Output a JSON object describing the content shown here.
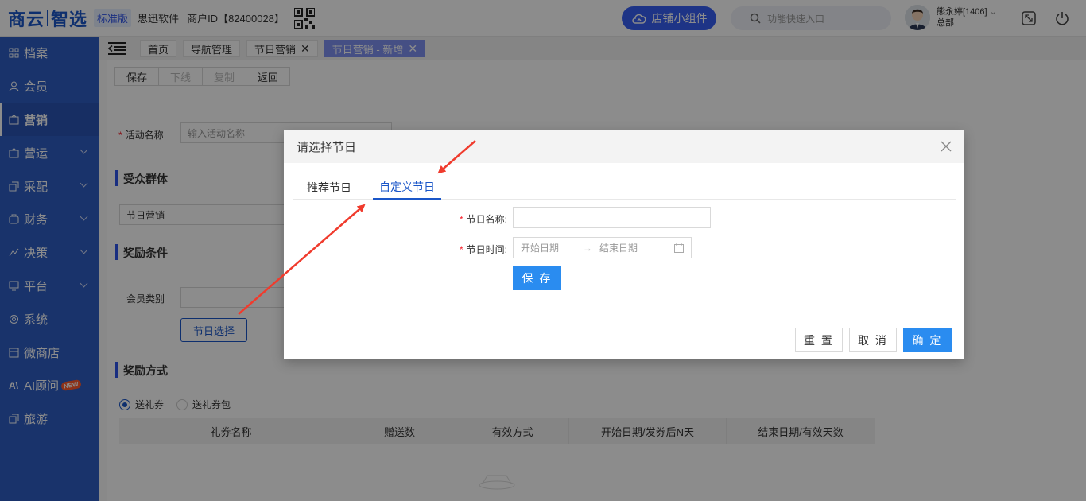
{
  "header": {
    "logo_left": "商云",
    "logo_right": "智选",
    "edition": "标准版",
    "company": "思迅软件",
    "merchant": "商户ID【82400028】",
    "widget_button": "店铺小组件",
    "search_placeholder": "功能快速入口",
    "user_name": "熊永婷[1406]",
    "user_org": "总部"
  },
  "sidebar": {
    "items": [
      {
        "label": "档案",
        "icon": "archive-icon"
      },
      {
        "label": "会员",
        "icon": "member-icon"
      },
      {
        "label": "营销",
        "icon": "marketing-icon",
        "active": true
      },
      {
        "label": "营运",
        "icon": "operation-icon"
      },
      {
        "label": "采配",
        "icon": "purchase-icon"
      },
      {
        "label": "财务",
        "icon": "finance-icon"
      },
      {
        "label": "决策",
        "icon": "decision-icon"
      },
      {
        "label": "平台",
        "icon": "platform-icon"
      },
      {
        "label": "系统",
        "icon": "system-icon"
      },
      {
        "label": "微商店",
        "icon": "micro-store-icon"
      },
      {
        "label": "AI顾问",
        "icon": "ai-icon",
        "badge": "NEW"
      },
      {
        "label": "旅游",
        "icon": "travel-icon"
      }
    ]
  },
  "tabs": [
    {
      "label": "首页"
    },
    {
      "label": "导航管理"
    },
    {
      "label": "节日营销",
      "closable": true
    },
    {
      "label": "节日营销 - 新增",
      "closable": true,
      "active": true
    }
  ],
  "toolbar": {
    "save": "保存",
    "offline": "下线",
    "copy": "复制",
    "back": "返回"
  },
  "form": {
    "activity_name_label": "活动名称",
    "activity_name_placeholder": "输入活动名称",
    "audience_title": "受众群体",
    "audience_value": "节日营销",
    "reward_condition_title": "奖励条件",
    "member_type_label": "会员类别",
    "holiday_select_button": "节日选择",
    "reward_method_title": "奖励方式",
    "radio_coupon": "送礼券",
    "radio_coupon_pack": "送礼券包",
    "table_headers": [
      "礼券名称",
      "赠送数",
      "有效方式",
      "开始日期/发券后N天",
      "结束日期/有效天数"
    ]
  },
  "modal": {
    "title": "请选择节日",
    "tab_recommended": "推荐节日",
    "tab_custom": "自定义节日",
    "name_label": "节日名称:",
    "time_label": "节日时间:",
    "start_placeholder": "开始日期",
    "end_placeholder": "结束日期",
    "save_button": "保 存",
    "reset_button": "重 置",
    "cancel_button": "取 消",
    "confirm_button": "确 定"
  },
  "colors": {
    "sidebar_bg": "#2f5ec4",
    "primary": "#2a8cf0",
    "active_tab": "#7f90f0",
    "annotation_arrow": "#f03b2d"
  }
}
